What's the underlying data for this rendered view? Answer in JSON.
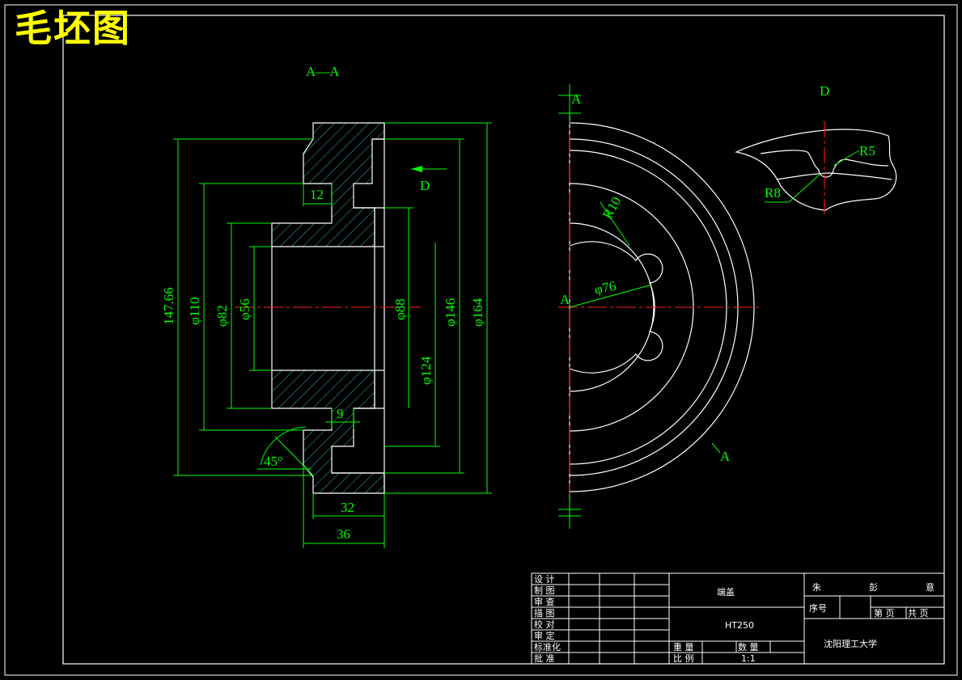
{
  "drawing_title": "毛坯图",
  "section_view": {
    "label": "A—A",
    "dims": {
      "d147": "147.66",
      "d110": "φ110",
      "d82": "φ82",
      "d56": "φ56",
      "d88": "φ88",
      "d146": "φ146",
      "d164": "φ164",
      "d124": "φ124",
      "w12": "12",
      "w9": "9",
      "w32": "32",
      "w36": "36",
      "angle": "45°"
    },
    "view_arrow": "D"
  },
  "front_view": {
    "cut_label": "A",
    "cut_label_bottom": "A",
    "center_label": "A",
    "r10": "R10",
    "d76": "φ76"
  },
  "detail_view": {
    "label": "D",
    "r5": "R5",
    "r8": "R8"
  },
  "title_block": {
    "left_rows": [
      "设 计",
      "制 图",
      "审 查",
      "描 图",
      "校 对",
      "审 定",
      "标准化",
      "批 准"
    ],
    "part_name": "端盖",
    "material": "HT250",
    "weight_label": "重 量",
    "qty_label": "数 量",
    "scale_label": "比 例",
    "scale_value": "1:1",
    "author": [
      "朱",
      "彭",
      "意"
    ],
    "seq_label": "序号",
    "sheet_label": "第 页",
    "total_label": "共 页",
    "school": "沈阳理工大学"
  }
}
